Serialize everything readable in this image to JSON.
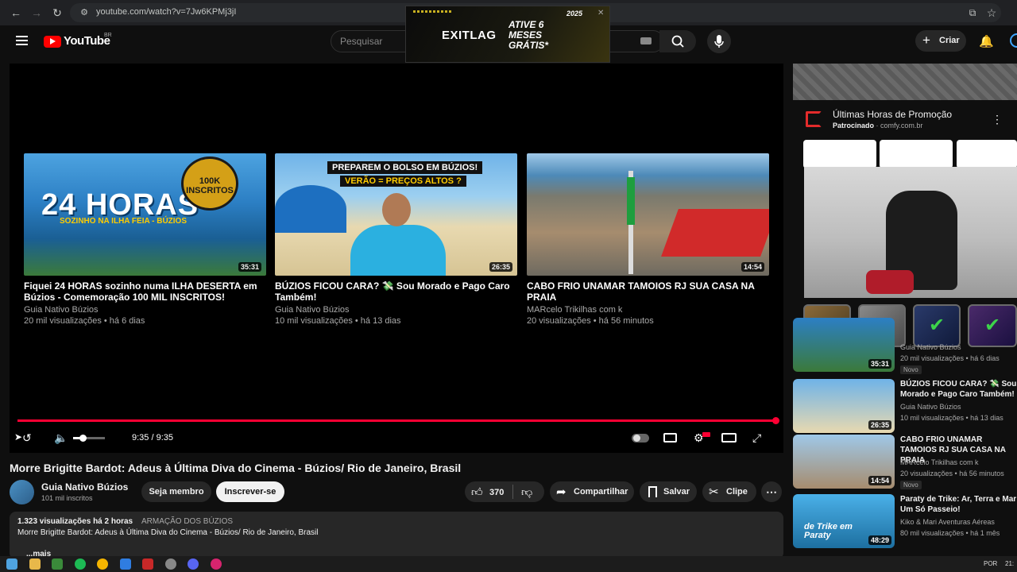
{
  "browser": {
    "url": "youtube.com/watch?v=7Jw6KPMj3jI"
  },
  "header": {
    "logo_text": "YouTube",
    "region": "BR",
    "search_placeholder": "Pesquisar",
    "create_label": "Criar"
  },
  "top_ad": {
    "brand": "EXITLAG",
    "tagline": "ATIVE 6 MESES GRÁTIS*",
    "year": "2025"
  },
  "player": {
    "time": "9:35 / 9:35",
    "progress_fraction": 1.0,
    "volume_fraction": 0.3,
    "end_screen": [
      {
        "thumb_text": "24 HORAS",
        "thumb_subtext": "SOZINHO NA ILHA FEIA - BÚZIOS",
        "badge_text": "100K INSCRITOS",
        "duration": "35:31",
        "title": "Fiquei 24 HORAS sozinho numa ILHA DESERTA em Búzios - Comemoração 100 MIL INSCRITOS!",
        "channel": "Guia Nativo Búzios",
        "meta": "20 mil visualizações • há 6 dias"
      },
      {
        "thumb_text": "PREPAREM O BOLSO EM BÚZIOS!",
        "thumb_subtext": "VERÃO = PREÇOS ALTOS ?",
        "duration": "26:35",
        "title": "BÚZIOS FICOU CARA? 💸 Sou Morado e Pago Caro Também!",
        "channel": "Guia Nativo Búzios",
        "meta": "10 mil visualizações • há 13 dias"
      },
      {
        "duration": "14:54",
        "title": "CABO FRIO UNAMAR TAMOIOS RJ SUA CASA NA PRAIA",
        "channel": "MARcelo Trikilhas com k",
        "meta": "20 visualizações • há 56 minutos"
      }
    ]
  },
  "video": {
    "title": "Morre Brigitte Bardot: Adeus à Última Diva do Cinema - Búzios/ Rio de Janeiro, Brasil",
    "channel": "Guia Nativo Búzios",
    "subscribers": "101 mil inscritos",
    "member_label": "Seja membro",
    "subscribe_label": "Inscrever-se",
    "likes": "370",
    "share_label": "Compartilhar",
    "save_label": "Salvar",
    "clip_label": "Clipe"
  },
  "description": {
    "stats": "1.323 visualizações  há 2 horas",
    "tag": "ARMAÇÃO DOS BÚZIOS",
    "text": "Morre Brigitte Bardot: Adeus à Última Diva do Cinema - Búzios/ Rio de Janeiro, Brasil",
    "more": "...mais"
  },
  "side_ad": {
    "title": "Últimas Horas de Promoção",
    "sponsor_label": "Patrocinado",
    "sponsor_domain": "· comfy.com.br"
  },
  "recommendations": [
    {
      "duration": "35:31",
      "title": "",
      "channel": "Guia Nativo Búzios",
      "meta": "20 mil visualizações • há 6 dias",
      "badge": "Novo"
    },
    {
      "duration": "26:35",
      "title": "BÚZIOS FICOU CARA? 💸 Sou Morado e Pago Caro Também!",
      "channel": "Guia Nativo Búzios",
      "meta": "10 mil visualizações • há 13 dias",
      "badge": ""
    },
    {
      "duration": "14:54",
      "title": "CABO FRIO UNAMAR TAMOIOS RJ SUA CASA NA PRAIA",
      "channel": "MARcelo Trikilhas com k",
      "meta": "20 visualizações • há 56 minutos",
      "badge": "Novo"
    },
    {
      "duration": "48:29",
      "title": "Paraty de Trike: Ar, Terra e Mar Um Só Passeio!",
      "channel": "Kiko & Mari Aventuras Aéreas",
      "meta": "80 mil visualizações • há 1 mês",
      "badge": "",
      "thumb_text": "de Trike em Paraty"
    }
  ],
  "taskbar": {
    "lang": "POR",
    "clock": "21:"
  },
  "colors": {
    "accent_red": "#ff0033",
    "background": "#0f0f0f",
    "surface": "#272727"
  }
}
